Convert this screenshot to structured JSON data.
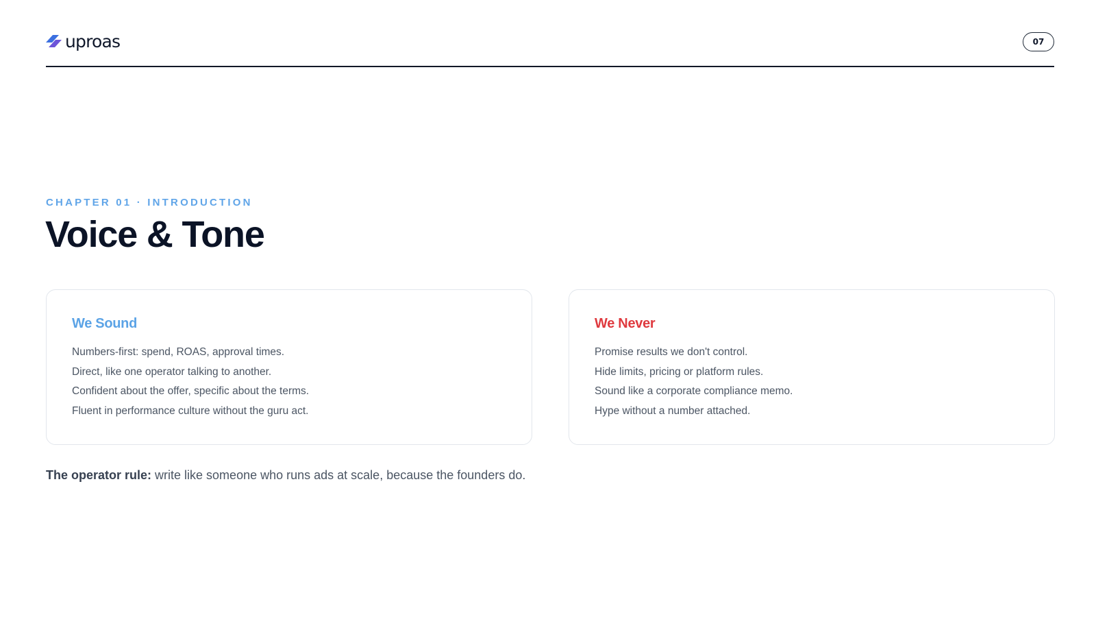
{
  "header": {
    "logo_text": "uproas",
    "page_number": "07"
  },
  "chapter": {
    "eyebrow": "CHAPTER 01 · INTRODUCTION",
    "title": "Voice & Tone"
  },
  "cards": {
    "sound": {
      "title": "We Sound",
      "items": [
        "Numbers-first: spend, ROAS, approval times.",
        "Direct, like one operator talking to another.",
        "Confident about the offer, specific about the terms.",
        "Fluent in performance culture without the guru act."
      ]
    },
    "never": {
      "title": "We Never",
      "items": [
        "Promise results we don't control.",
        "Hide limits, pricing or platform rules.",
        "Sound like a corporate compliance memo.",
        "Hype without a number attached."
      ]
    }
  },
  "rule": {
    "label": "The operator rule:",
    "text": " write like someone who runs ads at scale, because the founders do."
  },
  "colors": {
    "accent_blue": "#60a5e8",
    "accent_red": "#df3a3f",
    "logo_blue": "#3b6fe0",
    "logo_purple": "#6d55d9",
    "ink": "#0b1326"
  },
  "icons": {
    "logo": "slash-stripes-logo-icon"
  }
}
